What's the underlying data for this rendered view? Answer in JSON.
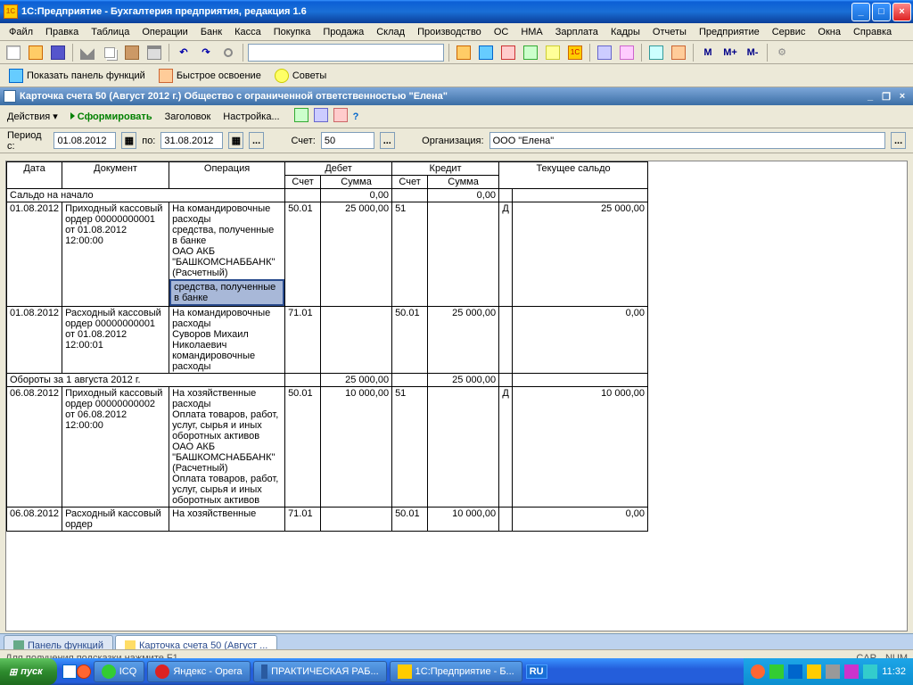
{
  "window": {
    "title": "1С:Предприятие - Бухгалтерия предприятия, редакция 1.6"
  },
  "menu": [
    "Файл",
    "Правка",
    "Таблица",
    "Операции",
    "Банк",
    "Касса",
    "Покупка",
    "Продажа",
    "Склад",
    "Производство",
    "ОС",
    "НМА",
    "Зарплата",
    "Кадры",
    "Отчеты",
    "Предприятие",
    "Сервис",
    "Окна",
    "Справка"
  ],
  "toolbar2": {
    "panel": "Показать панель функций",
    "fast": "Быстрое освоение",
    "tips": "Советы"
  },
  "doc": {
    "title": "Карточка счета 50 (Август 2012 г.) Общество с ограниченной ответственностью \"Елена\""
  },
  "actions": {
    "actions": "Действия",
    "form": "Сформировать",
    "header": "Заголовок",
    "settings": "Настройка..."
  },
  "params": {
    "period_lbl": "Период с:",
    "from": "01.08.2012",
    "to_lbl": "по:",
    "to": "31.08.2012",
    "account_lbl": "Счет:",
    "account": "50",
    "org_lbl": "Организация:",
    "org": "ООО \"Елена\""
  },
  "headers": {
    "date": "Дата",
    "doc": "Документ",
    "op": "Операция",
    "debit": "Дебет",
    "credit": "Кредит",
    "balance": "Текущее сальдо",
    "acc": "Счет",
    "sum": "Сумма"
  },
  "rows": {
    "startbal": {
      "label": "Сальдо на начало",
      "dsum": "0,00",
      "csum": "0,00"
    },
    "r1": {
      "date": "01.08.2012",
      "doc": "Приходный кассовый ордер 00000000001 от 01.08.2012 12:00:00",
      "op": "На командировочные расходы\nсредства, полученные в банке\nОАО АКБ \"БАШКОМСНАББАНК\" (Расчетный)",
      "opsel": "средства, полученные в банке",
      "dacc": "50.01",
      "dsum": "25 000,00",
      "cacc": "51",
      "csum": "",
      "bal_dc": "Д",
      "bal": "25 000,00"
    },
    "r2": {
      "date": "01.08.2012",
      "doc": "Расходный кассовый ордер 00000000001 от 01.08.2012 12:00:01",
      "op": "На командировочные расходы\nСуворов Михаил Николаевич командировочные расходы",
      "dacc": "71.01",
      "dsum": "",
      "cacc": "50.01",
      "csum": "25 000,00",
      "bal_dc": "",
      "bal": "0,00"
    },
    "turn1": {
      "label": "Обороты за 1 августа 2012 г.",
      "dsum": "25 000,00",
      "csum": "25 000,00"
    },
    "r3": {
      "date": "06.08.2012",
      "doc": "Приходный кассовый ордер 00000000002 от 06.08.2012 12:00:00",
      "op": "На хозяйственные расходы\nОплата товаров, работ, услуг, сырья и иных оборотных активов\nОАО АКБ \"БАШКОМСНАББАНК\" (Расчетный)\nОплата товаров, работ, услуг, сырья и иных оборотных активов",
      "dacc": "50.01",
      "dsum": "10 000,00",
      "cacc": "51",
      "csum": "",
      "bal_dc": "Д",
      "bal": "10 000,00"
    },
    "r4": {
      "date": "06.08.2012",
      "doc": "Расходный кассовый ордер",
      "op": "На хозяйственные",
      "dacc": "71.01",
      "dsum": "",
      "cacc": "50.01",
      "csum": "10 000,00",
      "bal_dc": "",
      "bal": "0,00"
    }
  },
  "mditabs": {
    "t1": "Панель функций",
    "t2": "Карточка счета 50 (Август ..."
  },
  "status": {
    "hint": "Для получения подсказки нажмите F1",
    "cap": "CAP",
    "num": "NUM"
  },
  "taskbar": {
    "start": "пуск",
    "tasks": [
      "ICQ",
      "Яндекс - Opera",
      "ПРАКТИЧЕСКАЯ РАБ...",
      "1С:Предприятие - Б..."
    ],
    "lang": "RU",
    "time": "11:32"
  },
  "m_buttons": [
    "M",
    "M+",
    "M-"
  ]
}
